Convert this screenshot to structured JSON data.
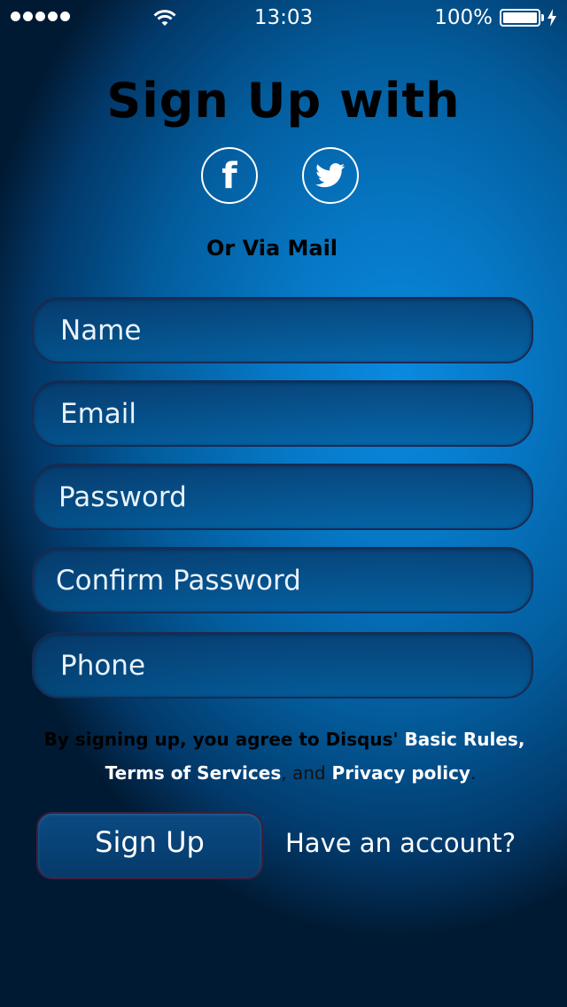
{
  "status_bar": {
    "signal_dots": 5,
    "time": "13:03",
    "battery_percent": "100%",
    "icons": [
      "signal-dots-icon",
      "wifi-icon",
      "battery-icon",
      "charging-bolt-icon"
    ]
  },
  "header": {
    "title": "Sign Up with",
    "social": [
      {
        "name": "facebook",
        "icon": "facebook-icon"
      },
      {
        "name": "twitter",
        "icon": "twitter-icon"
      }
    ],
    "subheading": "Or Via Mail"
  },
  "form": {
    "name_placeholder": "Name",
    "email_placeholder": "Email",
    "password_placeholder": "Password",
    "confirm_password_placeholder": "Confirm Password",
    "phone_placeholder": "Phone"
  },
  "terms": {
    "prefix": "By signing up, you agree to  Disqus'",
    "basic_rules": "Basic Rules,",
    "terms_of_services": "Terms of Services",
    "comma_and": ", and",
    "privacy_policy": "Privacy  policy",
    "period": "."
  },
  "actions": {
    "signup_label": "Sign Up",
    "have_account_label": "Have an account?"
  },
  "colors": {
    "background_accent": "#0a8ae0",
    "field_border": "#1b2a52",
    "title_text": "#000000",
    "link_text": "#ffffff"
  }
}
